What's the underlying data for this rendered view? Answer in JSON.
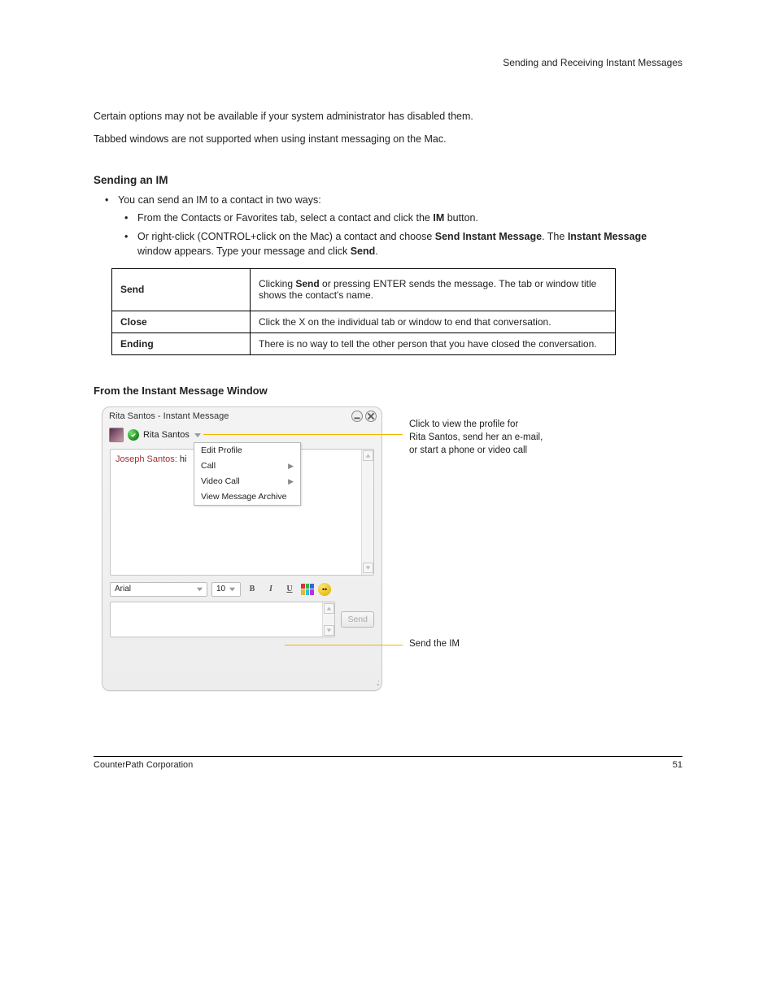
{
  "header": {
    "right": "Sending and Receiving Instant Messages"
  },
  "intro_paragraphs": [
    "Certain options may not be available if your system administrator has disabled them.",
    "Tabbed windows are not supported when using instant messaging on the Mac."
  ],
  "section_heading": "Sending an IM",
  "bullets": {
    "b0": "You can send an IM to a contact in two ways:",
    "s1": "From the Contacts or Favorites tab, select a contact and click the ",
    "s1_bold": "IM ",
    "s1_after": "button.",
    "s2a": "Or right-click (CONTROL+click on the Mac) a contact and choose ",
    "s2a_bold": "Send Instant Message",
    "s2b_prefix": "The ",
    "s2b_bold": "Instant Message ",
    "s2b_after": "window appears. Type your message and click ",
    "s2b_bold2": "Send",
    "s2b_tail": "."
  },
  "table": {
    "r0c0": "Send",
    "r0c1_prefix": "Clicking ",
    "r0c1_mid": "Send",
    "r0c1_suffix": " or pressing ENTER sends the message. The tab or window title shows the contact's name.",
    "r1c0": "Close",
    "r1c1": "Click the X on the individual tab or window to end that conversation.",
    "r2c0": "Ending",
    "r2c1": "There is no way to tell the other person that you have closed the conversation."
  },
  "subsection_heading": "From the Instant Message Window",
  "im": {
    "title": "Rita Santos - Instant Message",
    "contact_name": "Rita Santos",
    "menu": {
      "edit_profile": "Edit Profile",
      "call": "Call",
      "video_call": "Video Call",
      "view_archive": "View Message Archive"
    },
    "msg_sender": "Joseph Santos:",
    "msg_body": " hi",
    "font_name": "Arial",
    "font_size": "10",
    "send_label": "Send"
  },
  "callouts": {
    "top1": "Click to view the profile for",
    "top2": "Rita Santos, send her an e-mail,",
    "top3": "or start a phone or video call",
    "bottom": "Send the IM"
  },
  "footer": {
    "left": "CounterPath Corporation",
    "right": "51"
  }
}
